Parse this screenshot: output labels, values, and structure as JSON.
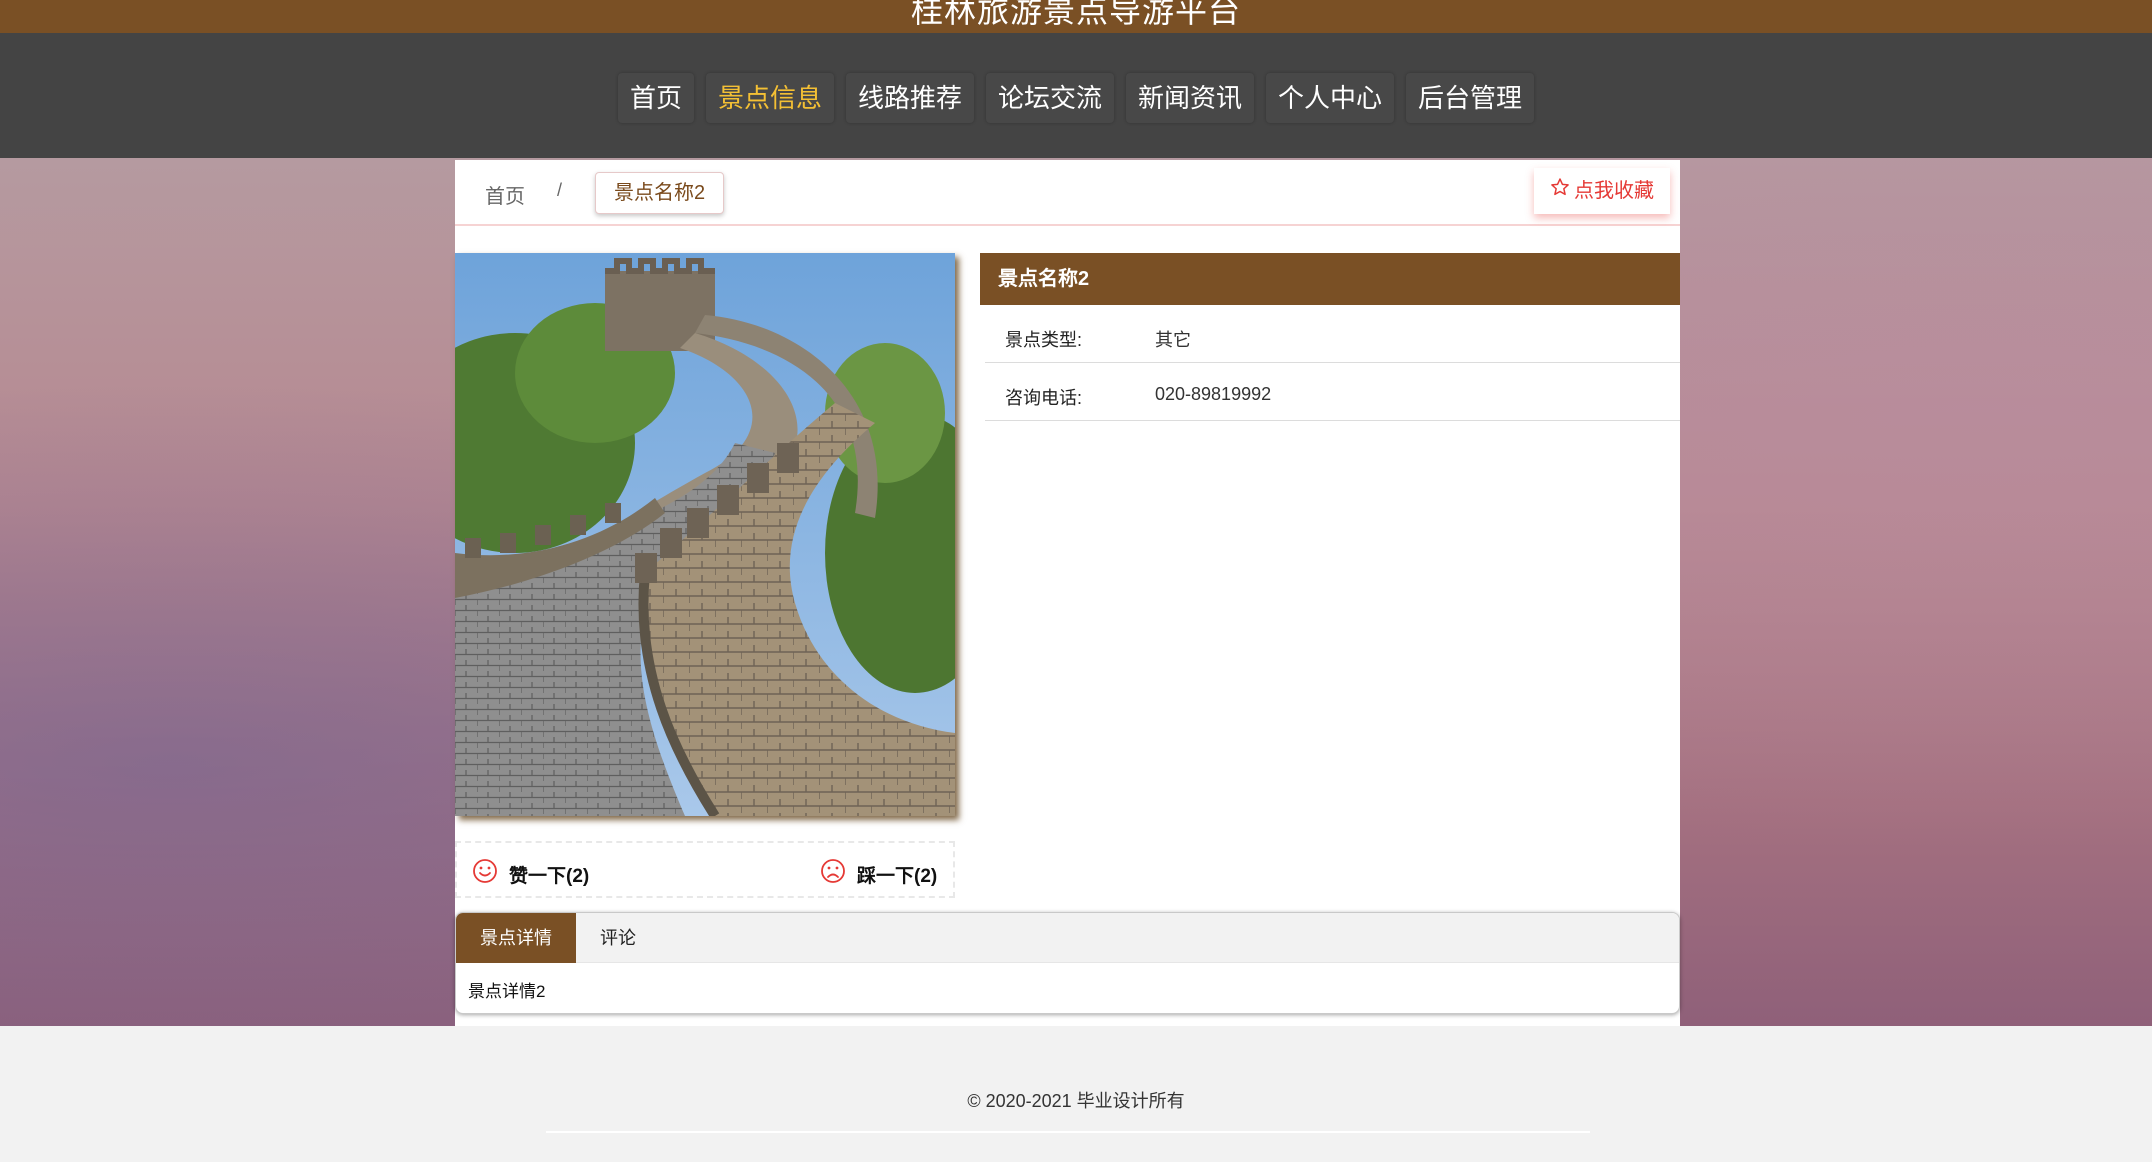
{
  "header": {
    "site_title": "桂林旅游景点导游平台"
  },
  "nav": {
    "items": [
      {
        "label": "首页"
      },
      {
        "label": "景点信息"
      },
      {
        "label": "线路推荐"
      },
      {
        "label": "论坛交流"
      },
      {
        "label": "新闻资讯"
      },
      {
        "label": "个人中心"
      },
      {
        "label": "后台管理"
      }
    ],
    "active_index": 1
  },
  "breadcrumb": {
    "home": "首页",
    "separator": "/",
    "current": "景点名称2"
  },
  "favorite": {
    "label": "点我收藏",
    "icon": "star-outline-icon"
  },
  "attraction": {
    "name": "景点名称2",
    "photo_icon": "great-wall-photo",
    "fields": [
      {
        "label": "景点类型:",
        "value": "其它"
      },
      {
        "label": "咨询电话:",
        "value": "020-89819992"
      }
    ]
  },
  "votes": {
    "like_label": "赞一下(2)",
    "dislike_label": "踩一下(2)",
    "like_icon": "smile-icon",
    "dislike_icon": "frown-icon"
  },
  "tabs": {
    "items": [
      {
        "label": "景点详情"
      },
      {
        "label": "评论"
      }
    ],
    "active_index": 0,
    "content": "景点详情2"
  },
  "footer": {
    "copyright": "© 2020-2021 毕业设计所有"
  },
  "colors": {
    "brand": "#7a5025",
    "nav_bg": "#444444",
    "nav_active": "#f4c034",
    "favorite": "#e53935"
  }
}
